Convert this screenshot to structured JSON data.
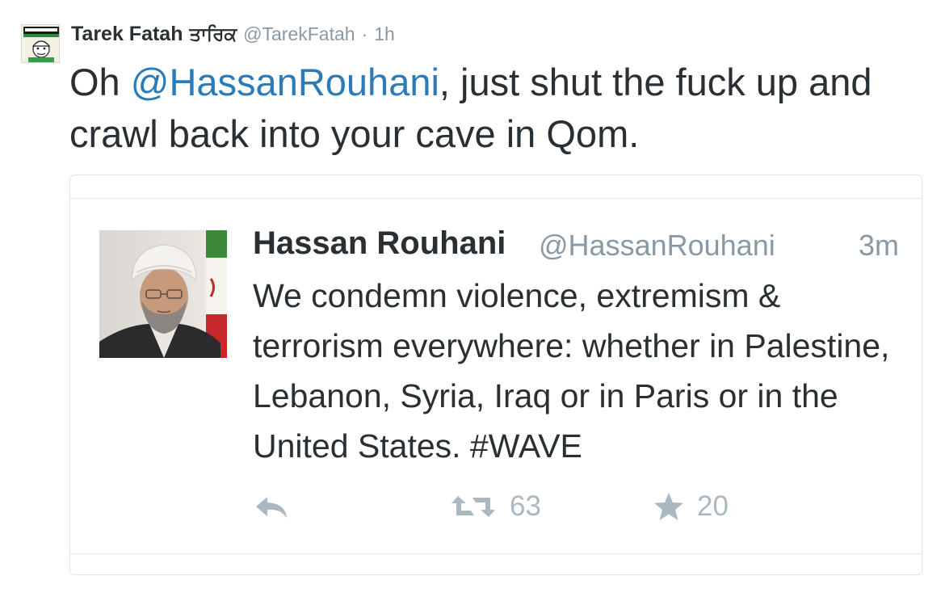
{
  "tweet": {
    "author_name": "Tarek Fatah",
    "author_name_alt": "ਤਾਰਿਕ",
    "handle": "@TarekFatah",
    "separator": "·",
    "time": "1h",
    "text_parts": [
      "Oh ",
      "@HassanRouhani",
      ", just shut the fuck up and crawl back into your cave in Qom."
    ],
    "avatar_icon": "charlie-hebdo-avatar-icon"
  },
  "quoted_tweet": {
    "author_name": "Hassan Rouhani",
    "handle": "@HassanRouhani",
    "time": "3m",
    "text": "We condemn violence, extremism & terrorism everywhere: whether in Palestine, Lebanon, Syria, Iraq or in Paris or in the United States. #WAVE",
    "photo_icon": "hassan-rouhani-avatar",
    "actions": {
      "reply_icon": "reply-icon",
      "retweet_icon": "retweet-icon",
      "retweet_count": "63",
      "favorite_icon": "star-icon",
      "favorite_count": "20"
    }
  },
  "colors": {
    "text": "#292f33",
    "muted": "#8899a6",
    "link": "#2b7bb9",
    "action": "#aab8c2",
    "border": "#e1e8ed"
  }
}
